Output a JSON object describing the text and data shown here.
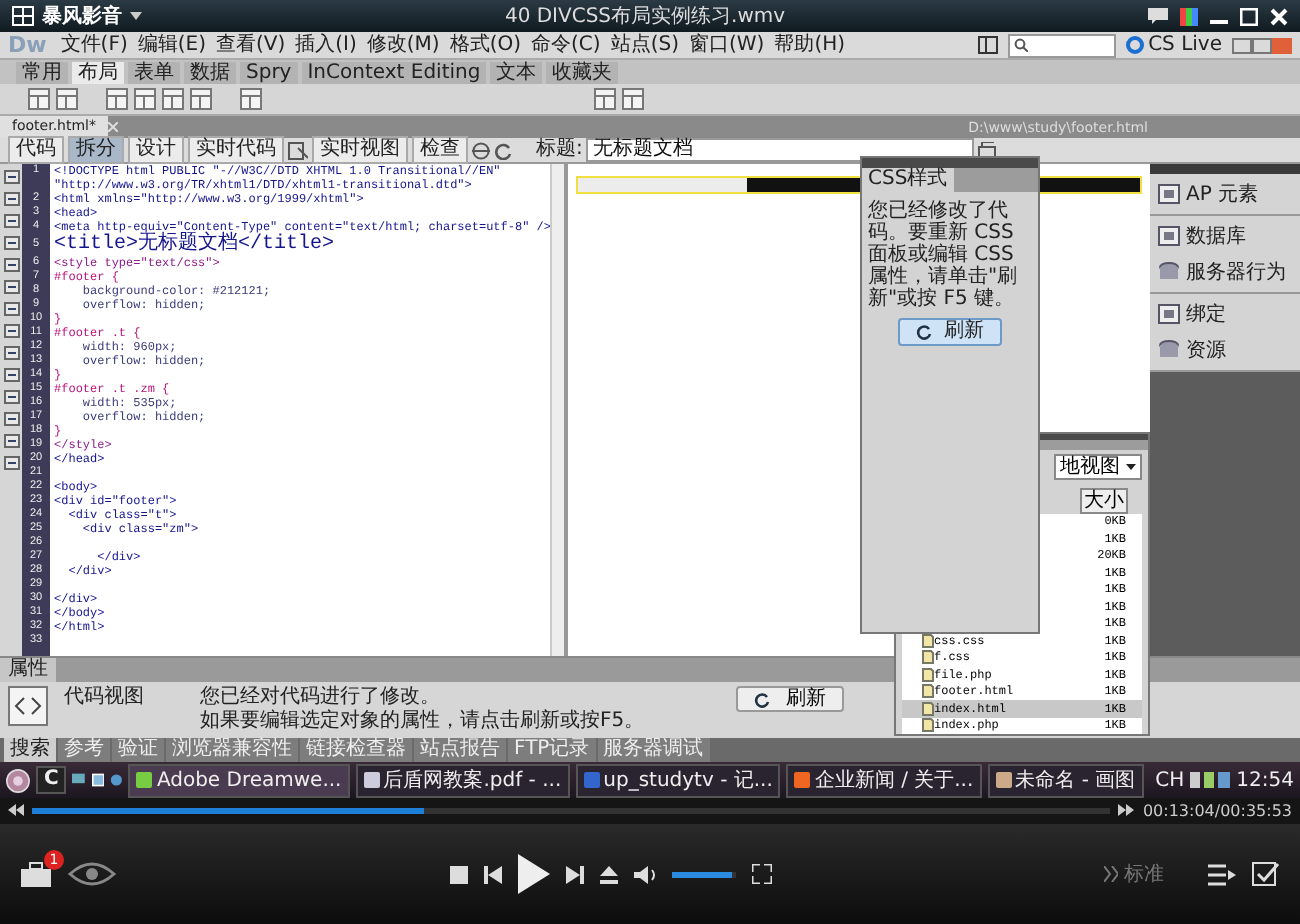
{
  "player": {
    "logo": "暴风影音",
    "title": "40 DIVCSS布局实例练习.wmv"
  },
  "dreamweaver": {
    "logo": "Dw",
    "menu": [
      "文件(F)",
      "编辑(E)",
      "查看(V)",
      "插入(I)",
      "修改(M)",
      "格式(O)",
      "命令(C)",
      "站点(S)",
      "窗口(W)",
      "帮助(H)"
    ],
    "cs_live": "CS Live",
    "insert_tabs": [
      {
        "label": "常用",
        "selected": false
      },
      {
        "label": "布局",
        "selected": true
      },
      {
        "label": "表单",
        "selected": false
      },
      {
        "label": "数据",
        "selected": false
      },
      {
        "label": "Spry",
        "selected": false
      },
      {
        "label": "InContext Editing",
        "selected": false
      },
      {
        "label": "文本",
        "selected": false
      },
      {
        "label": "收藏夹",
        "selected": false
      }
    ],
    "document_tab": "footer.html*",
    "file_path": "D:\\www\\study\\footer.html",
    "view_buttons": [
      {
        "label": "代码",
        "selected": false
      },
      {
        "label": "拆分",
        "selected": true
      },
      {
        "label": "设计",
        "selected": false
      },
      {
        "label": "实时代码",
        "selected": false
      },
      {
        "label": "实时视图",
        "selected": false
      },
      {
        "label": "检查",
        "selected": false
      }
    ],
    "title_label": "标题:",
    "title_value": "无标题文档",
    "code_lines": [
      {
        "number": "1",
        "text": "<!DOCTYPE html PUBLIC \"-//W3C//DTD XHTML 1.0 Transitional//EN\"",
        "kind": "tag"
      },
      {
        "text": "\"http://www.w3.org/TR/xhtml1/DTD/xhtml1-transitional.dtd\">",
        "kind": "tag"
      },
      {
        "number": "2",
        "text": "<html xmlns=\"http://www.w3.org/1999/xhtml\">",
        "kind": "tag"
      },
      {
        "number": "3",
        "text": "<head>",
        "kind": "tag"
      },
      {
        "number": "4",
        "text": "<meta http-equiv=\"Content-Type\" content=\"text/html; charset=utf-8\" />",
        "kind": "tag"
      },
      {
        "number": "5",
        "text": "<title>无标题文档</title>",
        "kind": "title"
      },
      {
        "number": "6",
        "text": "<style type=\"text/css\">",
        "kind": "style"
      },
      {
        "number": "7",
        "text": "#footer {",
        "kind": "selector"
      },
      {
        "number": "8",
        "text": "    background-color: #212121;",
        "kind": "declaration"
      },
      {
        "number": "9",
        "text": "    overflow: hidden;",
        "kind": "declaration"
      },
      {
        "number": "10",
        "text": "}",
        "kind": "selector"
      },
      {
        "number": "11",
        "text": "#footer .t {",
        "kind": "selector"
      },
      {
        "number": "12",
        "text": "    width: 960px;",
        "kind": "declaration"
      },
      {
        "number": "13",
        "text": "    overflow: hidden;",
        "kind": "declaration"
      },
      {
        "number": "14",
        "text": "}",
        "kind": "selector"
      },
      {
        "number": "15",
        "text": "#footer .t .zm {",
        "kind": "selector"
      },
      {
        "number": "16",
        "text": "    width: 535px;",
        "kind": "declaration"
      },
      {
        "number": "17",
        "text": "    overflow: hidden;",
        "kind": "declaration"
      },
      {
        "number": "18",
        "text": "}",
        "kind": "selector"
      },
      {
        "number": "19",
        "text": "</style>",
        "kind": "style"
      },
      {
        "number": "20",
        "text": "</head>",
        "kind": "tag"
      },
      {
        "number": "21",
        "kind": "blank"
      },
      {
        "number": "22",
        "text": "<body>",
        "kind": "tag"
      },
      {
        "number": "23",
        "text": "<div id=\"footer\">",
        "kind": "tag"
      },
      {
        "number": "24",
        "text": "  <div class=\"t\">",
        "kind": "tag"
      },
      {
        "number": "25",
        "text": "    <div class=\"zm\">",
        "kind": "tag"
      },
      {
        "number": "26",
        "kind": "blank"
      },
      {
        "number": "27",
        "text": "      </div>",
        "kind": "tag"
      },
      {
        "number": "28",
        "text": "  </div>",
        "kind": "tag"
      },
      {
        "number": "29",
        "kind": "blank"
      },
      {
        "number": "30",
        "text": "</div>",
        "kind": "tag"
      },
      {
        "number": "31",
        "text": "</body>",
        "kind": "tag"
      },
      {
        "number": "32",
        "text": "</html>",
        "kind": "tag"
      },
      {
        "number": "33",
        "kind": "blank"
      }
    ],
    "css_panel": {
      "tab": "CSS样式",
      "message": "您已经修改了代码。要重新 CSS 面板或编辑 CSS 属性，请单击\"刷新\"或按 F5 键。",
      "button": "刷新"
    },
    "files_panel": {
      "view": "地视图",
      "size_header": "大小",
      "rows": [
        {
          "size": "0KB",
          "selected": false
        },
        {
          "size": "1KB",
          "selected": false
        },
        {
          "size": "20KB",
          "selected": false
        },
        {
          "size": "1KB",
          "selected": false
        },
        {
          "size": "1KB",
          "selected": false
        },
        {
          "size": "1KB",
          "selected": false
        },
        {
          "size": "1KB",
          "selected": false
        },
        {
          "name": "css.css",
          "size": "1KB",
          "selected": false
        },
        {
          "name": "f.css",
          "size": "1KB",
          "selected": false
        },
        {
          "name": "file.php",
          "size": "1KB",
          "selected": false
        },
        {
          "name": "footer.html",
          "size": "1KB",
          "selected": false
        },
        {
          "name": "index.html",
          "size": "1KB",
          "selected": true
        },
        {
          "name": "index.php",
          "size": "1KB",
          "selected": false
        }
      ]
    },
    "side_groups": [
      [
        "AP 元素"
      ],
      [
        "数据库",
        "服务器行为"
      ],
      [
        "绑定",
        "资源"
      ]
    ],
    "properties": {
      "title": "属性",
      "mode": "代码视图",
      "message_lines": [
        "您已经对代码进行了修改。",
        "如果要编辑选定对象的属性，请点击刷新或按F5。"
      ],
      "button": "刷新"
    },
    "results_tabs": [
      {
        "label": "搜索",
        "selected": true
      },
      {
        "label": "参考",
        "selected": false
      },
      {
        "label": "验证",
        "selected": false
      },
      {
        "label": "浏览器兼容性",
        "selected": false
      },
      {
        "label": "链接检查器",
        "selected": false
      },
      {
        "label": "站点报告",
        "selected": false
      },
      {
        "label": "FTP记录",
        "selected": false
      },
      {
        "label": "服务器调试",
        "selected": false
      }
    ]
  },
  "taskbar": {
    "quick": "C",
    "items": [
      {
        "label": "Adobe Dreamwe...",
        "selected": true
      },
      {
        "label": "后盾网教案.pdf - ...",
        "selected": false
      },
      {
        "label": "up_studytv - 记...",
        "selected": false
      },
      {
        "label": "企业新闻 / 关于...",
        "selected": false
      },
      {
        "label": "未命名 - 画图",
        "selected": false
      }
    ],
    "language": "CH",
    "clock": "12:54"
  },
  "playback": {
    "progress": {
      "level": 0.364
    },
    "time": "00:13:04/00:35:53",
    "volume": {
      "level": 0.95
    },
    "quality": "标准",
    "notification_count": "1"
  }
}
